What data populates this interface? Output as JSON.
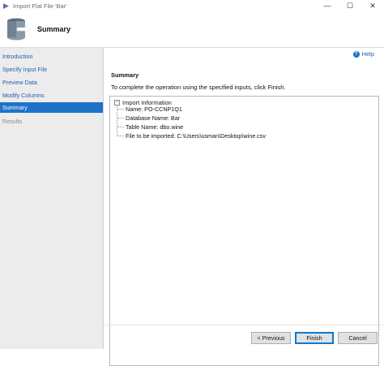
{
  "window": {
    "title": "Import Flat File 'Bar'",
    "controls": {
      "minimize": "—",
      "maximize": "☐",
      "close": "✕"
    }
  },
  "header": {
    "title": "Summary",
    "icon": "database-import-icon"
  },
  "sidebar": {
    "items": [
      {
        "label": "Introduction",
        "state": "link"
      },
      {
        "label": "Specify Input File",
        "state": "link"
      },
      {
        "label": "Preview Data",
        "state": "link"
      },
      {
        "label": "Modify Columns",
        "state": "link"
      },
      {
        "label": "Summary",
        "state": "active"
      },
      {
        "label": "Results",
        "state": "disabled"
      }
    ]
  },
  "main": {
    "help_label": "Help",
    "section_title": "Summary",
    "description": "To complete the operation using the specified inputs, click Finish.",
    "tree": {
      "root": "Import Information",
      "expander": "−",
      "children": [
        "Name: PO-CCNP1Q1",
        "Database Name: Bar",
        "Table Name: dbo.wine",
        "File to be imported: C:\\Users\\usman\\Desktop\\wine.csv"
      ]
    }
  },
  "footer": {
    "previous": "< Previous",
    "finish": "Finish",
    "cancel": "Cancel"
  },
  "colors": {
    "accent": "#1e73c9",
    "link": "#1f5fae",
    "sidebar_bg": "#ececec"
  }
}
